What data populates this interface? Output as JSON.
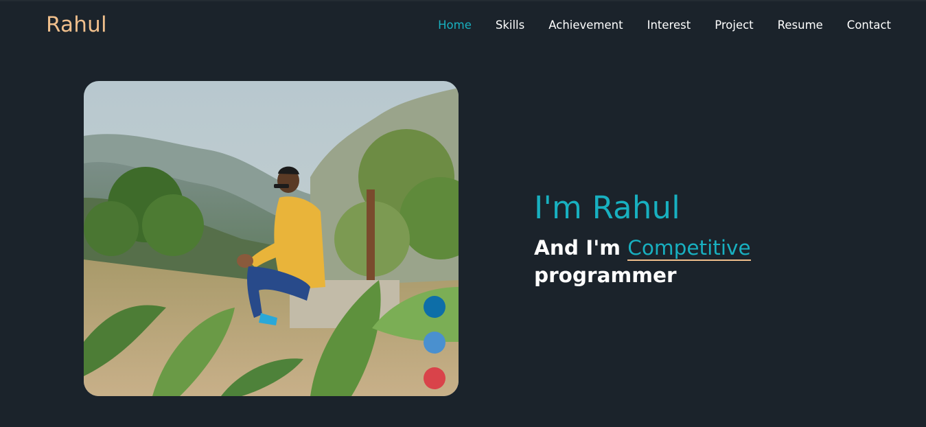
{
  "header": {
    "brand": "Rahul",
    "nav": [
      "Home",
      "Skills",
      "Achievement",
      "Interest",
      "Project",
      "Resume",
      "Contact"
    ],
    "active_nav": "Home"
  },
  "hero": {
    "title": "I'm Rahul",
    "subtitle_prefix": "And I'm",
    "role_highlight": "Competitive",
    "role_suffix": "programmer"
  },
  "social_icons": [
    {
      "name": "linkedin-icon",
      "color": "#0d6ea8"
    },
    {
      "name": "twitter-icon",
      "color": "#4a90cf"
    },
    {
      "name": "instagram-icon",
      "color": "#d9434a"
    }
  ],
  "colors": {
    "background": "#1b232b",
    "accent": "#18b0c0",
    "brand": "#f0bf8c",
    "text": "#ffffff"
  }
}
